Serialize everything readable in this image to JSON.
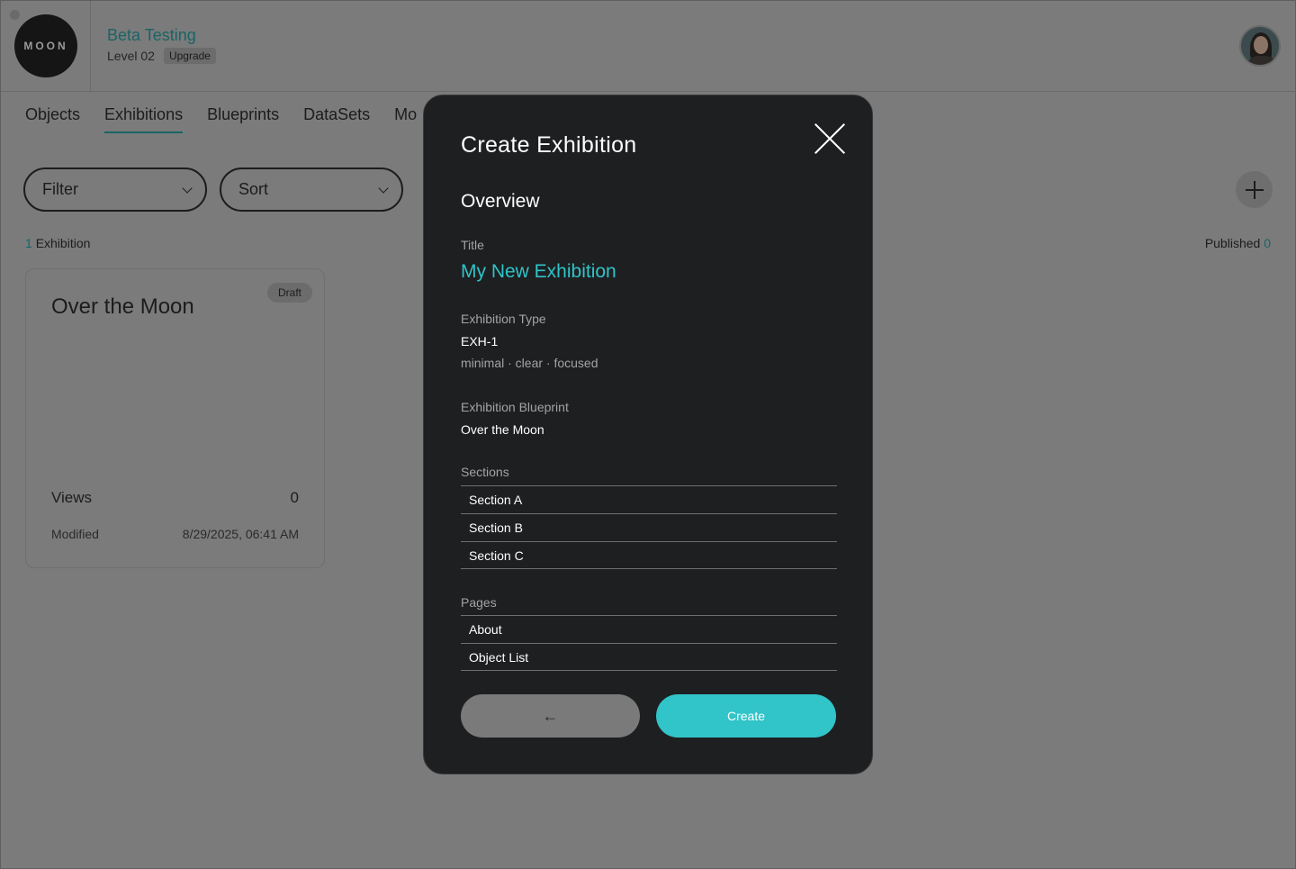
{
  "header": {
    "logo_text": "MOON",
    "account_name": "Beta Testing",
    "level": "Level 02",
    "upgrade_label": "Upgrade"
  },
  "tabs": [
    {
      "label": "Objects"
    },
    {
      "label": "Exhibitions",
      "active": true
    },
    {
      "label": "Blueprints"
    },
    {
      "label": "DataSets"
    },
    {
      "label": "Mo"
    }
  ],
  "filters": {
    "filter_label": "Filter",
    "sort_label": "Sort"
  },
  "summary": {
    "count": "1",
    "count_label": "Exhibition",
    "published_label": "Published",
    "published_count": "0"
  },
  "card": {
    "title": "Over the Moon",
    "status": "Draft",
    "views_label": "Views",
    "views_value": "0",
    "modified_label": "Modified",
    "modified_value": "8/29/2025, 06:41 AM"
  },
  "modal": {
    "title": "Create Exhibition",
    "overview_heading": "Overview",
    "title_label": "Title",
    "title_value": "My New Exhibition",
    "type_label": "Exhibition Type",
    "type_value": "EXH-1",
    "type_tags": "minimal · clear · focused",
    "blueprint_label": "Exhibition Blueprint",
    "blueprint_value": "Over the Moon",
    "sections_label": "Sections",
    "sections": [
      "Section A",
      "Section B",
      "Section C"
    ],
    "pages_label": "Pages",
    "pages": [
      "About",
      "Object List"
    ],
    "back_icon": "arrow-left-icon",
    "back_symbol": "←",
    "create_label": "Create"
  },
  "colors": {
    "accent": "#31c4c9",
    "modal_bg": "#1e1f21",
    "overlay_bg": "#7b7b7b"
  }
}
